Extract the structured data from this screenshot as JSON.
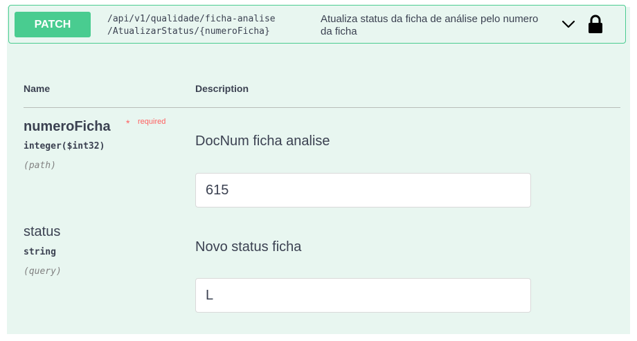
{
  "operation": {
    "method": "PATCH",
    "path": "/api/v1/qualidade/ficha-analise\n/AtualizarStatus/{numeroFicha}",
    "summary": "Atualiza status da ficha de análise pelo numero da ficha",
    "accent_color": "#49cc90",
    "background_color": "#e8f6f0",
    "icons": [
      "chevron-down-icon",
      "lock-icon"
    ]
  },
  "table": {
    "headers": {
      "name": "Name",
      "description": "Description"
    }
  },
  "parameters": [
    {
      "name": "numeroFicha",
      "required_marker": "*",
      "required_label": "required",
      "type": "integer($int32)",
      "in": "(path)",
      "description": "DocNum ficha analise",
      "value": "615"
    },
    {
      "name": "status",
      "type": "string",
      "in": "(query)",
      "description": "Novo status ficha",
      "value": "L"
    }
  ]
}
